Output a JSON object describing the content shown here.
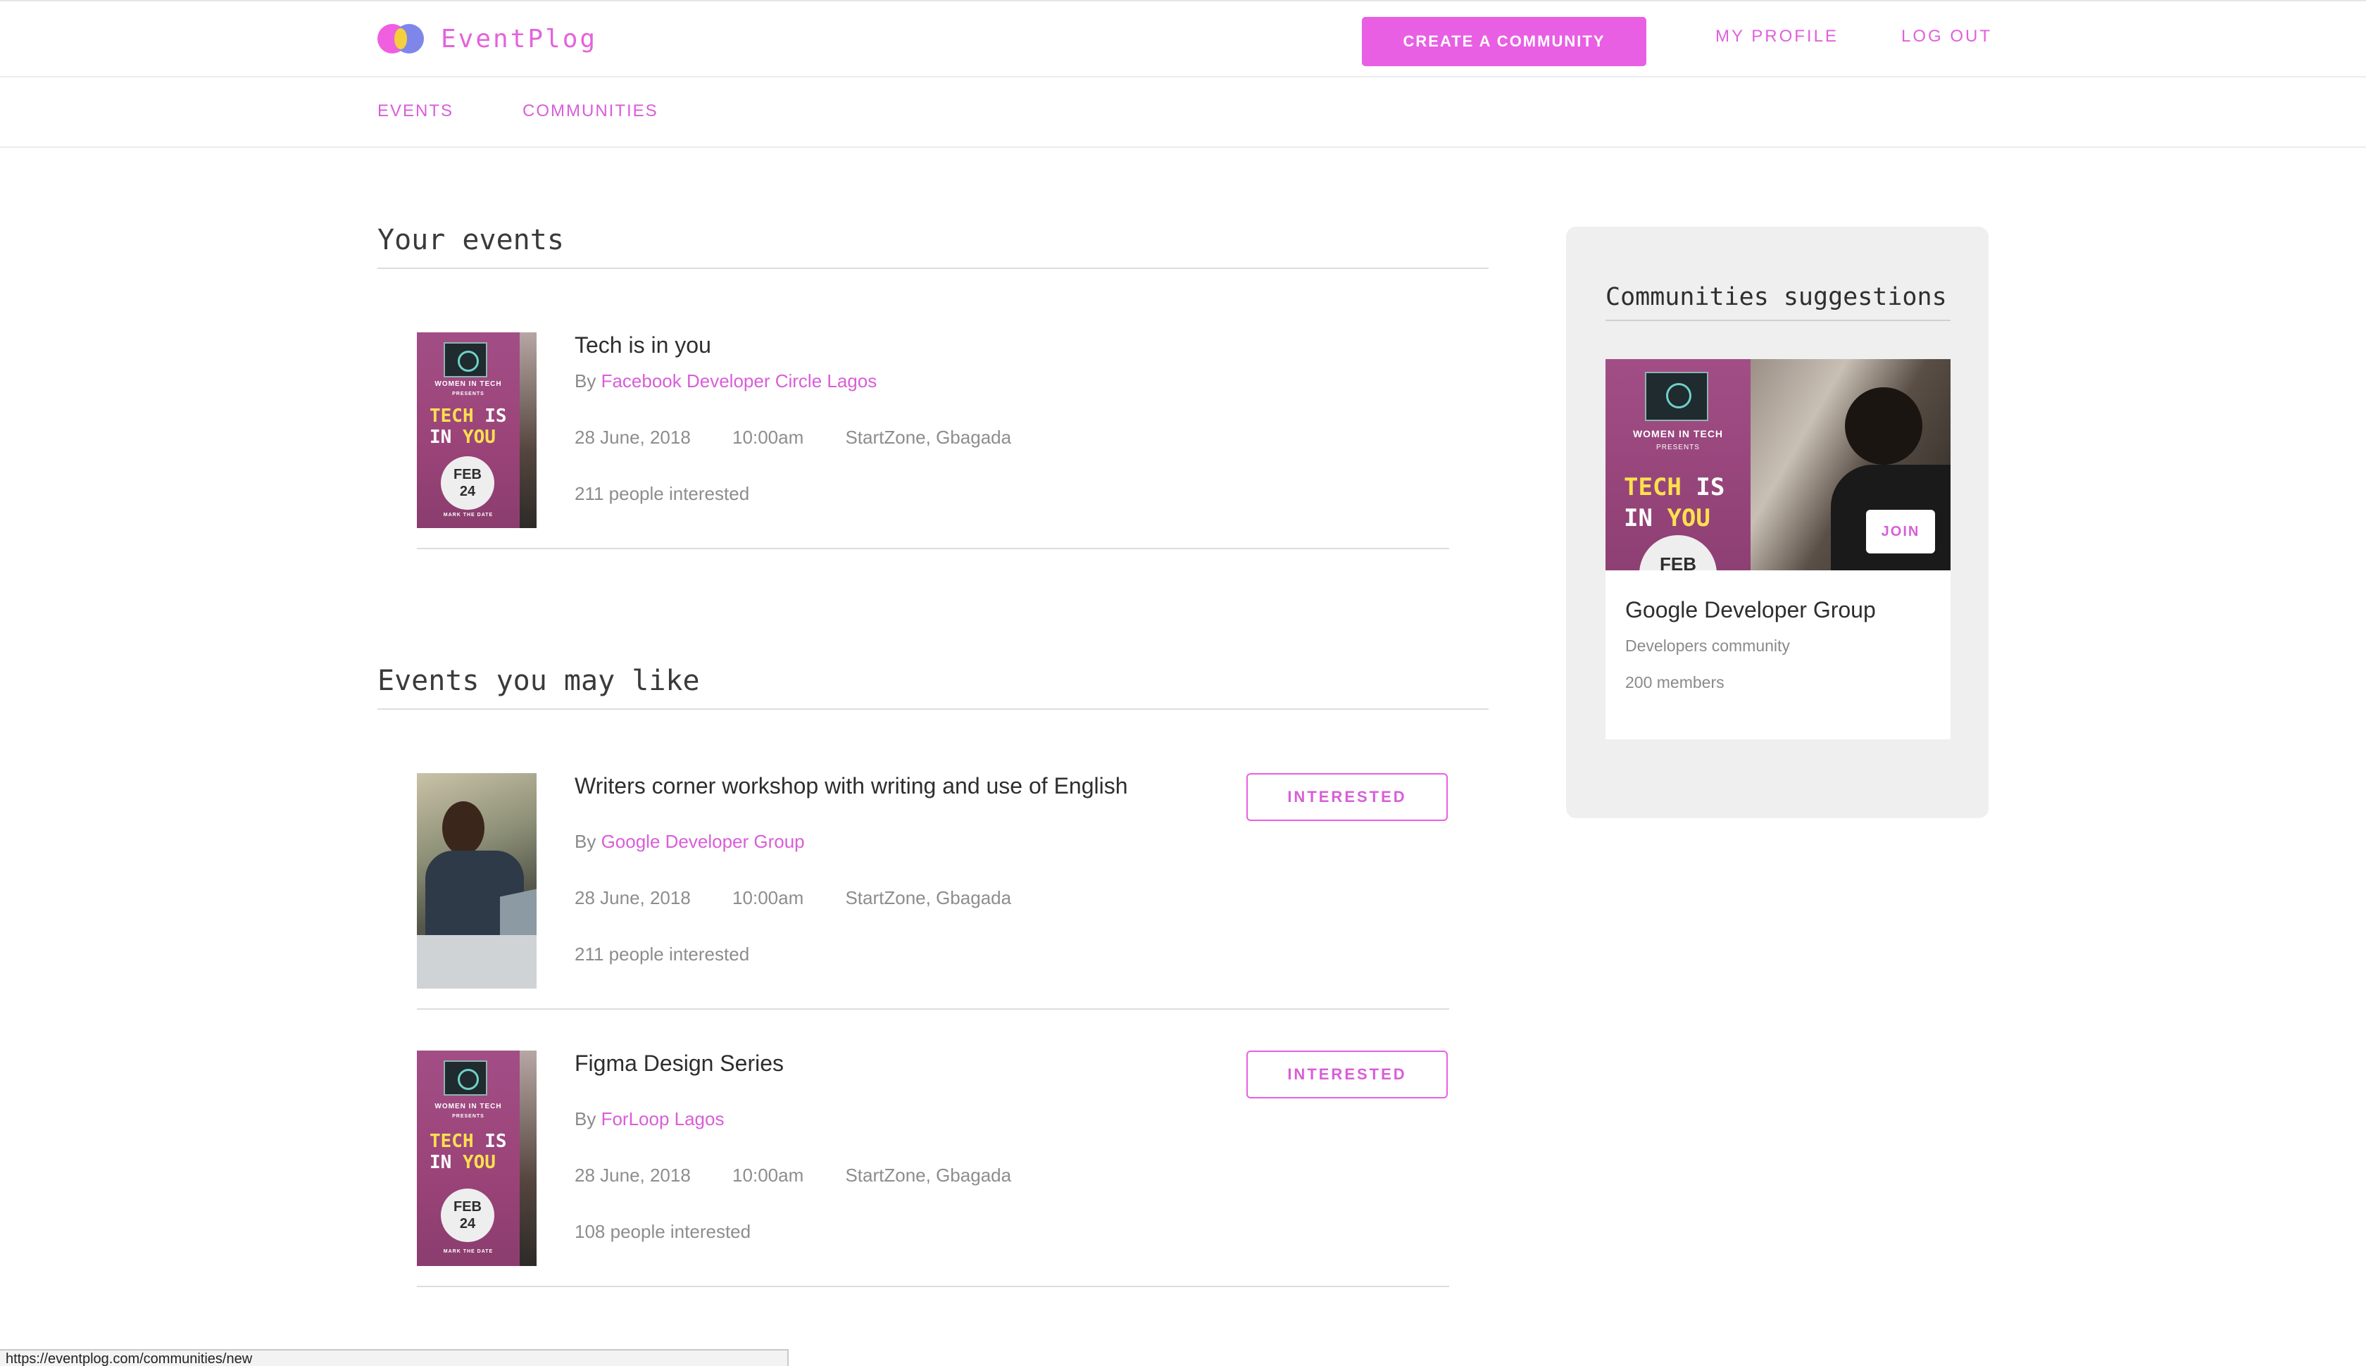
{
  "app": {
    "name": "EventPlog"
  },
  "header": {
    "create_label": "CREATE A COMMUNITY",
    "profile_label": "MY PROFILE",
    "logout_label": "LOG OUT"
  },
  "subnav": {
    "events_label": "EVENTS",
    "communities_label": "COMMUNITIES"
  },
  "your_events": {
    "heading": "Your events",
    "items": [
      {
        "title": "Tech is in you",
        "by": "By",
        "organizer": "Facebook Developer Circle Lagos",
        "date": "28 June, 2018",
        "time": "10:00am",
        "location": "StartZone, Gbagada",
        "interested": "211 people interested",
        "poster": {
          "org": "WOMEN IN TECH",
          "presents": "PRESENTS",
          "line1a": "TECH",
          "line1b": "IS",
          "line2a": "IN",
          "line2b": "YOU",
          "month": "FEB",
          "day": "24",
          "foot": "MARK THE DATE"
        }
      }
    ]
  },
  "may_like": {
    "heading": "Events you may like",
    "button_label": "INTERESTED",
    "items": [
      {
        "title": "Writers corner workshop with writing and use of English",
        "by": "By",
        "organizer": "Google Developer Group",
        "date": "28 June, 2018",
        "time": "10:00am",
        "location": "StartZone, Gbagada",
        "interested": "211 people interested"
      },
      {
        "title": "Figma Design Series",
        "by": "By",
        "organizer": "ForLoop Lagos",
        "date": "28 June, 2018",
        "time": "10:00am",
        "location": "StartZone, Gbagada",
        "interested": "108 people interested",
        "poster": {
          "org": "WOMEN IN TECH",
          "presents": "PRESENTS",
          "line1a": "TECH",
          "line1b": "IS",
          "line2a": "IN",
          "line2b": "YOU",
          "month": "FEB",
          "day": "24",
          "foot": "MARK THE DATE"
        }
      }
    ]
  },
  "sidebar": {
    "heading": "Communities suggestions",
    "card": {
      "name": "Google Developer Group",
      "description": "Developers community",
      "members": "200 members",
      "join_label": "JOIN",
      "poster": {
        "org": "WOMEN IN TECH",
        "presents": "PRESENTS",
        "line1a": "TECH",
        "line1b": "IS",
        "line2a": "IN",
        "line2b": "YOU",
        "month": "FEB"
      }
    }
  },
  "status_bar": {
    "url": "https://eventplog.com/communities/new"
  },
  "colors": {
    "accent": "#e85fe4",
    "link": "#d95ed8",
    "poster": "#a24e86",
    "sidebar_bg": "#efefef"
  }
}
